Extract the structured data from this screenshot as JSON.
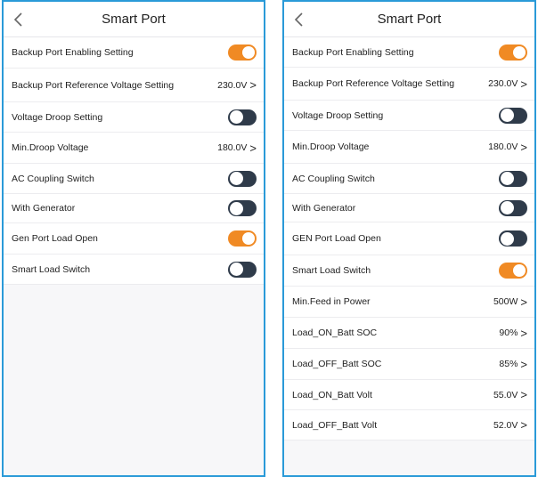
{
  "left": {
    "title": "Smart Port",
    "rows": [
      {
        "label": "Backup Port Enabling Setting",
        "type": "toggle",
        "on": true
      },
      {
        "label": "Backup Port Reference Voltage Setting",
        "type": "value",
        "value": "230.0V"
      },
      {
        "label": "Voltage Droop Setting",
        "type": "toggle",
        "on": false
      },
      {
        "label": "Min.Droop Voltage",
        "type": "value",
        "value": "180.0V"
      },
      {
        "label": "AC Coupling Switch",
        "type": "toggle",
        "on": false
      },
      {
        "label": "With Generator",
        "type": "toggle",
        "on": false
      },
      {
        "label": "Gen Port Load Open",
        "type": "toggle",
        "on": true
      },
      {
        "label": "Smart Load Switch",
        "type": "toggle",
        "on": false
      }
    ]
  },
  "right": {
    "title": "Smart Port",
    "rows": [
      {
        "label": "Backup Port Enabling Setting",
        "type": "toggle",
        "on": true
      },
      {
        "label": "Backup Port Reference Voltage Setting",
        "type": "value",
        "value": "230.0V"
      },
      {
        "label": "Voltage Droop Setting",
        "type": "toggle",
        "on": false
      },
      {
        "label": "Min.Droop Voltage",
        "type": "value",
        "value": "180.0V"
      },
      {
        "label": "AC Coupling Switch",
        "type": "toggle",
        "on": false
      },
      {
        "label": "With Generator",
        "type": "toggle",
        "on": false
      },
      {
        "label": "GEN Port Load Open",
        "type": "toggle",
        "on": false
      },
      {
        "label": "Smart Load Switch",
        "type": "toggle",
        "on": true
      },
      {
        "label": "Min.Feed in Power",
        "type": "value",
        "value": "500W"
      },
      {
        "label": "Load_ON_Batt SOC",
        "type": "value",
        "value": "90%"
      },
      {
        "label": "Load_OFF_Batt SOC",
        "type": "value",
        "value": "85%"
      },
      {
        "label": "Load_ON_Batt Volt",
        "type": "value",
        "value": "55.0V"
      },
      {
        "label": "Load_OFF_Batt Volt",
        "type": "value",
        "value": "52.0V"
      }
    ]
  },
  "icons": {
    "back": "chevron-left-icon",
    "disclosure": "chevron-right-icon"
  },
  "colors": {
    "frame": "#2a9ad8",
    "toggle_on": "#f08a24",
    "toggle_off": "#2f3b4a"
  }
}
